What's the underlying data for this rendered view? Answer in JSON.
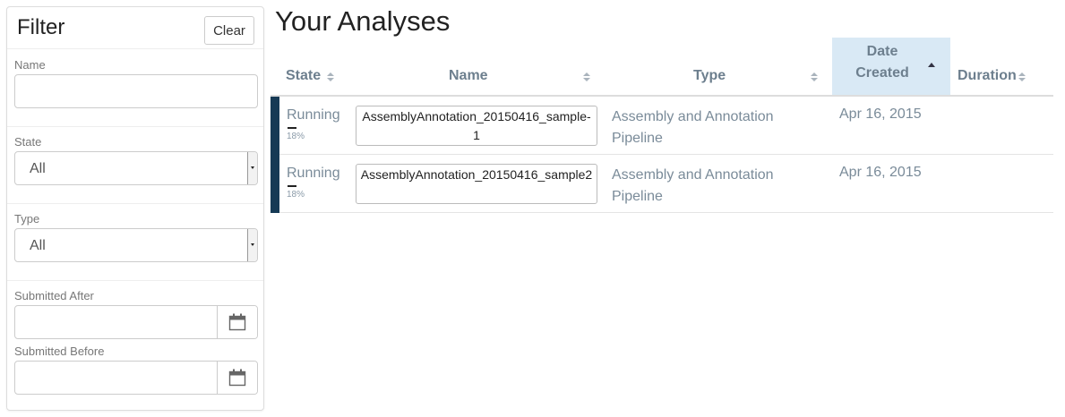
{
  "filter": {
    "title": "Filter",
    "clear_label": "Clear",
    "name": {
      "label": "Name",
      "value": "",
      "placeholder": ""
    },
    "state": {
      "label": "State",
      "selected": "All"
    },
    "type": {
      "label": "Type",
      "selected": "All"
    },
    "submitted_after": {
      "label": "Submitted After",
      "value": ""
    },
    "submitted_before": {
      "label": "Submitted Before",
      "value": ""
    }
  },
  "main": {
    "title": "Your Analyses",
    "columns": {
      "state": "State",
      "name": "Name",
      "type": "Type",
      "date_created_line1": "Date",
      "date_created_line2": "Created",
      "duration": "Duration"
    },
    "sorted_column": "Date Created",
    "sort_direction": "ascending",
    "rows": [
      {
        "state": "Running",
        "progress": 0.18,
        "progress_label": "18%",
        "name": "AssemblyAnnotation_20150416_sample-1",
        "type": "Assembly and Annotation Pipeline",
        "date_created": "Apr 16, 2015",
        "duration": ""
      },
      {
        "state": "Running",
        "progress": 0.18,
        "progress_label": "18%",
        "name": "AssemblyAnnotation_20150416_sample2",
        "type": "Assembly and Annotation Pipeline",
        "date_created": "Apr 16, 2015",
        "duration": ""
      }
    ]
  },
  "colors": {
    "row_accent": "#163a55",
    "active_header_bg": "#d9e9f5",
    "muted_text": "#7a8b99"
  },
  "icons": {
    "calendar": "calendar-icon",
    "sort": "sort-icon",
    "sort_ascending": "sort-ascending-icon"
  }
}
